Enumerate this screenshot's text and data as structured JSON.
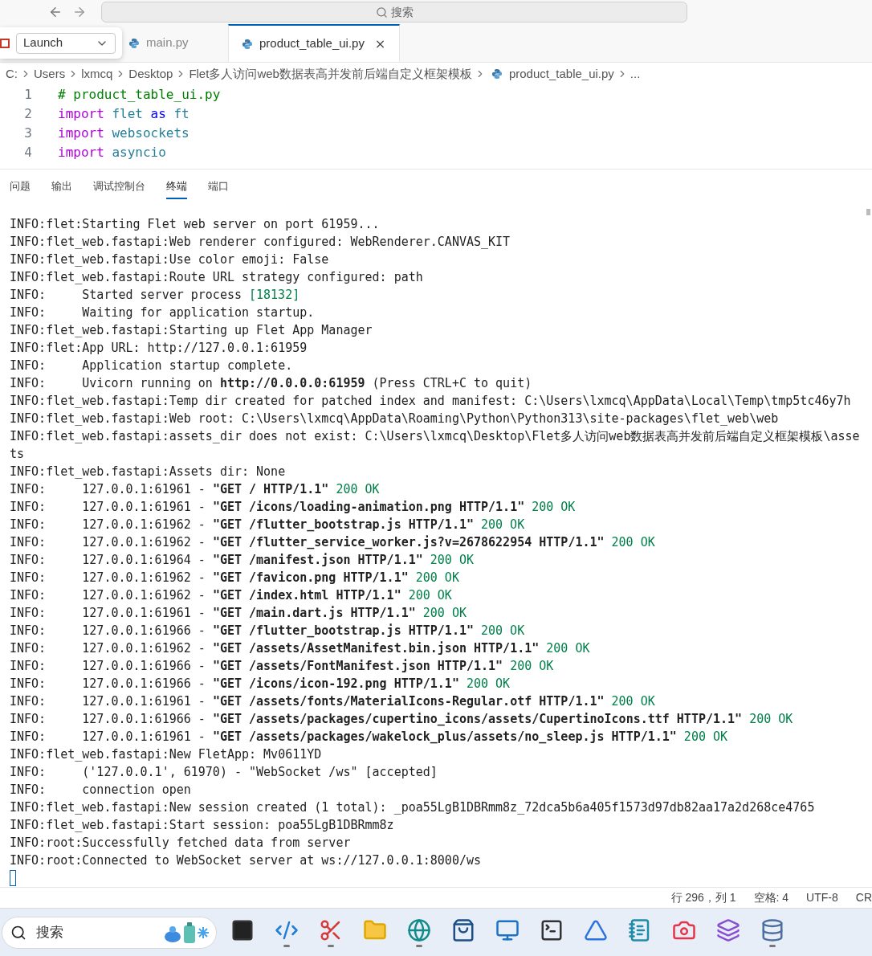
{
  "title_bar": {
    "search_placeholder": "搜索"
  },
  "launch": {
    "value": "Launch"
  },
  "tabs": [
    {
      "label": "main.py",
      "selected": false
    },
    {
      "label": "product_table_ui.py",
      "selected": true
    }
  ],
  "breadcrumb": [
    {
      "label": "C:",
      "kind": "text"
    },
    {
      "label": "Users",
      "kind": "text"
    },
    {
      "label": "lxmcq",
      "kind": "text"
    },
    {
      "label": "Desktop",
      "kind": "text"
    },
    {
      "label": "Flet多人访问web数据表高并发前后端自定义框架模板",
      "kind": "text"
    },
    {
      "label": "product_table_ui.py",
      "kind": "file"
    },
    {
      "label": "...",
      "kind": "text"
    }
  ],
  "editor": {
    "lines": [
      {
        "number": "1",
        "tokens": [
          {
            "text": "# product_table_ui.py",
            "kind": "comment"
          }
        ]
      },
      {
        "number": "2",
        "tokens": [
          {
            "text": "import",
            "kind": "keyword"
          },
          {
            "text": "flet",
            "kind": "module"
          },
          {
            "text": "as",
            "kind": "operator"
          },
          {
            "text": "ft",
            "kind": "module"
          }
        ]
      },
      {
        "number": "3",
        "tokens": [
          {
            "text": "import",
            "kind": "keyword"
          },
          {
            "text": "websockets",
            "kind": "module"
          }
        ]
      },
      {
        "number": "4",
        "tokens": [
          {
            "text": "import",
            "kind": "keyword"
          },
          {
            "text": "asyncio",
            "kind": "module"
          }
        ]
      }
    ]
  },
  "panel_tabs": [
    {
      "label": "问题",
      "selected": false
    },
    {
      "label": "输出",
      "selected": false
    },
    {
      "label": "调试控制台",
      "selected": false
    },
    {
      "label": "终端",
      "selected": true
    },
    {
      "label": "端口",
      "selected": false
    }
  ],
  "terminal": {
    "lines": [
      {
        "text": "INFO:flet:Starting Flet web server on port 61959..."
      },
      {
        "text": "INFO:flet_web.fastapi:Web renderer configured: WebRenderer.CANVAS_KIT"
      },
      {
        "text": "INFO:flet_web.fastapi:Use color emoji: False"
      },
      {
        "text": "INFO:flet_web.fastapi:Route URL strategy configured: path"
      },
      {
        "text": "INFO:     Started server process",
        "result": "[18132]"
      },
      {
        "text": "INFO:     Waiting for application startup."
      },
      {
        "text": "INFO:flet_web.fastapi:Starting up Flet App Manager"
      },
      {
        "text": "INFO:flet:App URL: http://127.0.0.1:61959"
      },
      {
        "text": "INFO:     Application startup complete."
      },
      {
        "text": "INFO:     Uvicorn running on **http://0.0.0.0:61959** (Press CTRL+C to quit)"
      },
      {
        "text": "INFO:flet_web.fastapi:Temp dir created for patched index and manifest: C:\\Users\\lxmcq\\AppData\\Local\\Temp\\tmp5tc46y7h"
      },
      {
        "text": "INFO:flet_web.fastapi:Web root: C:\\Users\\lxmcq\\AppData\\Roaming\\Python\\Python313\\site-packages\\flet_web\\web"
      },
      {
        "text": "INFO:flet_web.fastapi:assets_dir does not exist: C:\\Users\\lxmcq\\Desktop\\Flet多人访问web数据表高并发前后端自定义框架模板\\assets"
      },
      {
        "text": "INFO:flet_web.fastapi:Assets dir: None"
      },
      {
        "text": "INFO:     127.0.0.1:61961 - **\"GET / HTTP/1.1\"**",
        "result": "200 OK"
      },
      {
        "text": "INFO:     127.0.0.1:61961 - **\"GET /icons/loading-animation.png HTTP/1.1\"**",
        "result": "200 OK"
      },
      {
        "text": "INFO:     127.0.0.1:61962 - **\"GET /flutter_bootstrap.js HTTP/1.1\"**",
        "result": "200 OK"
      },
      {
        "text": "INFO:     127.0.0.1:61962 - **\"GET /flutter_service_worker.js?v=2678622954 HTTP/1.1\"**",
        "result": "200 OK"
      },
      {
        "text": "INFO:     127.0.0.1:61964 - **\"GET /manifest.json HTTP/1.1\"**",
        "result": "200 OK"
      },
      {
        "text": "INFO:     127.0.0.1:61962 - **\"GET /favicon.png HTTP/1.1\"**",
        "result": "200 OK"
      },
      {
        "text": "INFO:     127.0.0.1:61962 - **\"GET /index.html HTTP/1.1\"**",
        "result": "200 OK"
      },
      {
        "text": "INFO:     127.0.0.1:61961 - **\"GET /main.dart.js HTTP/1.1\"**",
        "result": "200 OK"
      },
      {
        "text": "INFO:     127.0.0.1:61966 - **\"GET /flutter_bootstrap.js HTTP/1.1\"**",
        "result": "200 OK"
      },
      {
        "text": "INFO:     127.0.0.1:61962 - **\"GET /assets/AssetManifest.bin.json HTTP/1.1\"**",
        "result": "200 OK"
      },
      {
        "text": "INFO:     127.0.0.1:61966 - **\"GET /assets/FontManifest.json HTTP/1.1\"**",
        "result": "200 OK"
      },
      {
        "text": "INFO:     127.0.0.1:61966 - **\"GET /icons/icon-192.png HTTP/1.1\"**",
        "result": "200 OK"
      },
      {
        "text": "INFO:     127.0.0.1:61961 - **\"GET /assets/fonts/MaterialIcons-Regular.otf HTTP/1.1\"**",
        "result": "200 OK"
      },
      {
        "text": "INFO:     127.0.0.1:61966 - **\"GET /assets/packages/cupertino_icons/assets/CupertinoIcons.ttf HTTP/1.1\"**",
        "result": "200 OK"
      },
      {
        "text": "INFO:     127.0.0.1:61961 - **\"GET /assets/packages/wakelock_plus/assets/no_sleep.js HTTP/1.1\"**",
        "result": "200 OK"
      },
      {
        "text": "INFO:flet_web.fastapi:New FletApp: Mv0611YD"
      },
      {
        "text": "INFO:     ('127.0.0.1', 61970) - \"WebSocket /ws\" [accepted]"
      },
      {
        "text": "INFO:     connection open"
      },
      {
        "text": "INFO:flet_web.fastapi:New session created (1 total): _poa55LgB1DBRmm8z_72dca5b6a405f1573d97db82aa17a2d268ce4765"
      },
      {
        "text": "INFO:flet_web.fastapi:Start session: poa55LgB1DBRmm8z"
      },
      {
        "text": "INFO:root:Successfully fetched data from server"
      },
      {
        "text": "INFO:root:Connected to WebSocket server at ws://127.0.0.1:8000/ws"
      }
    ]
  },
  "status_bar": [
    "行 296，列 1",
    "空格: 4",
    "UTF-8",
    "CR"
  ],
  "taskbar": {
    "search_placeholder": "搜索",
    "apps": [
      {
        "kind": "taskview",
        "running": false
      },
      {
        "kind": "code",
        "running": true
      },
      {
        "kind": "snip",
        "running": true
      },
      {
        "kind": "folder",
        "running": false
      },
      {
        "kind": "browser",
        "running": true
      },
      {
        "kind": "store",
        "running": false
      },
      {
        "kind": "remote",
        "running": false
      },
      {
        "kind": "terminal",
        "running": false
      },
      {
        "kind": "studio",
        "running": false
      },
      {
        "kind": "notepad",
        "running": false
      },
      {
        "kind": "camera",
        "running": false
      },
      {
        "kind": "vs",
        "running": false
      },
      {
        "kind": "database",
        "running": true
      }
    ]
  }
}
